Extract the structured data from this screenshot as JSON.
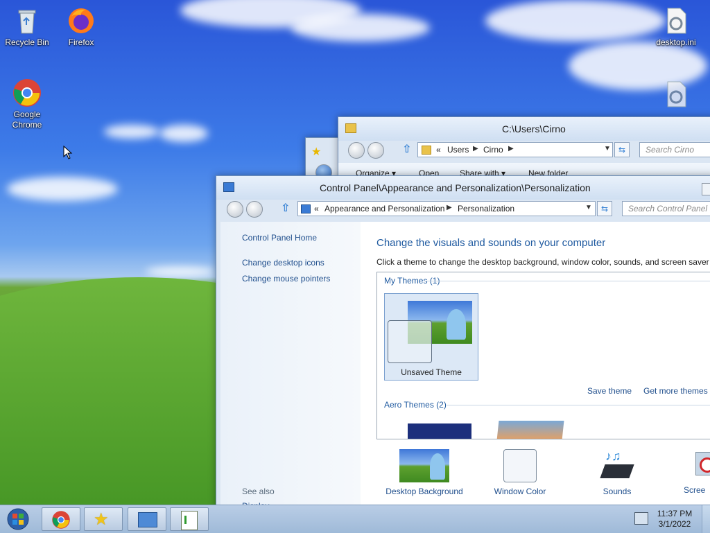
{
  "desktop": {
    "icons": [
      {
        "label": "Recycle Bin"
      },
      {
        "label": "Firefox"
      },
      {
        "label": "Google Chrome"
      },
      {
        "label": "desktop.ini"
      }
    ]
  },
  "explorer_window": {
    "title": "C:\\Users\\Cirno",
    "breadcrumb": [
      "«",
      "Users",
      "Cirno"
    ],
    "search_placeholder": "Search Cirno",
    "toolbar": [
      "Organize ▾",
      "Open",
      "Share with ▾",
      "New folder"
    ]
  },
  "personalization_window": {
    "title": "Control Panel\\Appearance and Personalization\\Personalization",
    "breadcrumb": [
      "«",
      "Appearance and Personalization",
      "Personalization"
    ],
    "search_placeholder": "Search Control Panel",
    "sidebar": {
      "home": "Control Panel Home",
      "links": [
        "Change desktop icons",
        "Change mouse pointers"
      ],
      "see_also": "See also",
      "see_also_item": "Display"
    },
    "heading": "Change the visuals and sounds on your computer",
    "subheading": "Click a theme to change the desktop background, window color, sounds, and screen saver a",
    "my_themes_label": "My Themes (1)",
    "selected_theme": "Unsaved Theme",
    "save_theme": "Save theme",
    "get_more_themes": "Get more themes o",
    "aero_themes_label": "Aero Themes (2)",
    "bottom_items": [
      {
        "label": "Desktop Background"
      },
      {
        "label": "Window Color"
      },
      {
        "label": "Sounds"
      },
      {
        "label": "Scree"
      }
    ]
  },
  "taskbar": {
    "time": "11:37 PM",
    "date": "3/1/2022"
  },
  "colors": {
    "link": "#1f4e8c",
    "heading": "#1f5aa0",
    "accent_blue": "#2a56d8"
  }
}
